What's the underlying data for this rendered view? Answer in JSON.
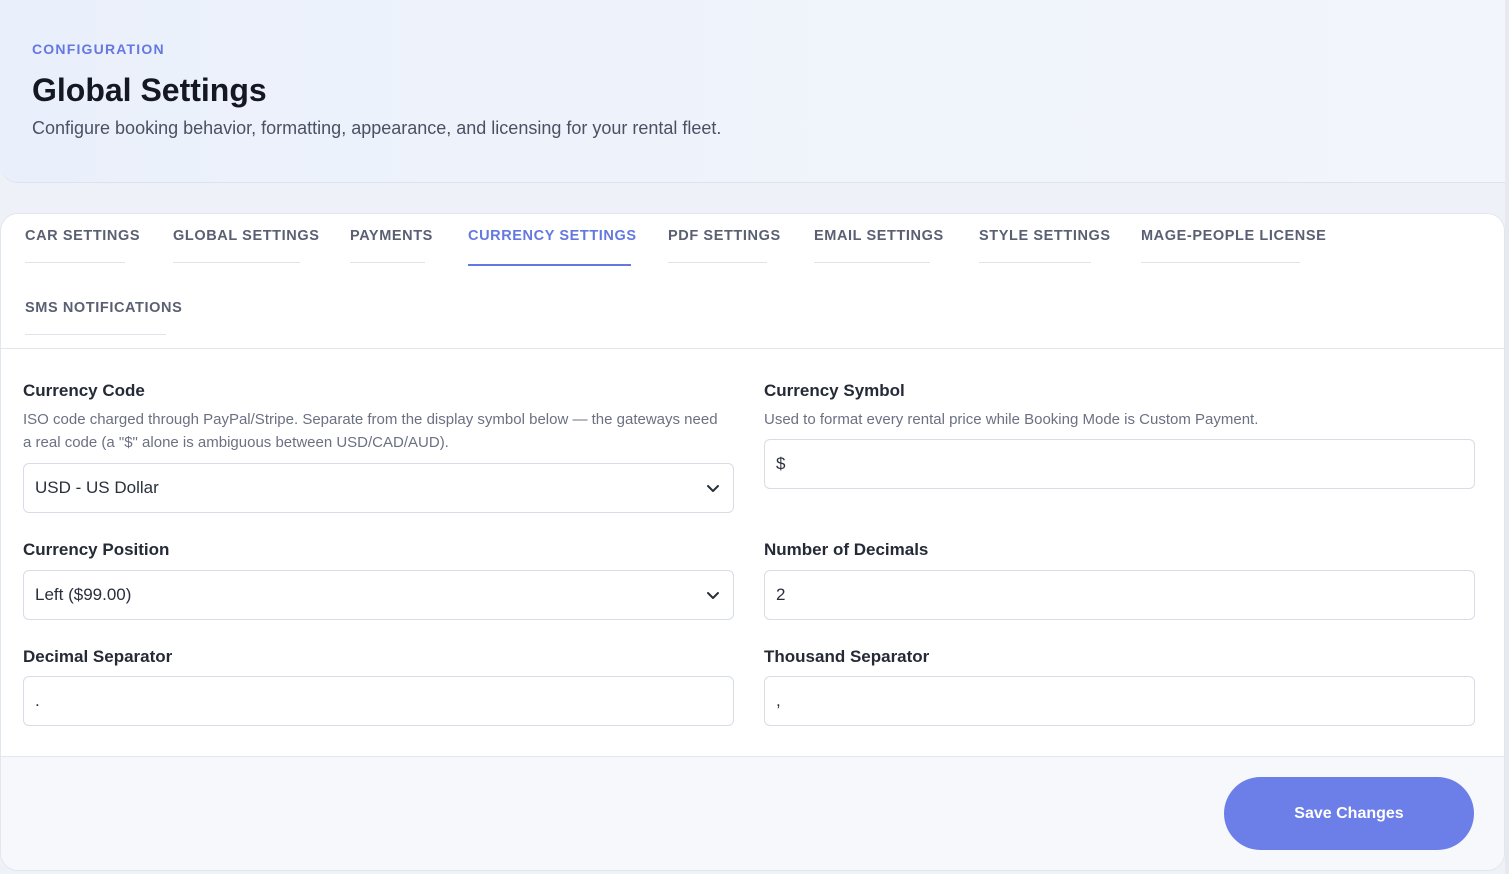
{
  "header": {
    "eyebrow": "CONFIGURATION",
    "title": "Global Settings",
    "subtitle": "Configure booking behavior, formatting, appearance, and licensing for your rental fleet."
  },
  "tabs": [
    {
      "label": "CAR SETTINGS",
      "active": false
    },
    {
      "label": "GLOBAL SETTINGS",
      "active": false
    },
    {
      "label": "PAYMENTS",
      "active": false
    },
    {
      "label": "CURRENCY SETTINGS",
      "active": true
    },
    {
      "label": "PDF SETTINGS",
      "active": false
    },
    {
      "label": "EMAIL SETTINGS",
      "active": false
    },
    {
      "label": "STYLE SETTINGS",
      "active": false
    },
    {
      "label": "MAGE-PEOPLE LICENSE",
      "active": false
    },
    {
      "label": "SMS NOTIFICATIONS",
      "active": false
    }
  ],
  "fields": {
    "currency_code": {
      "label": "Currency Code",
      "help": "ISO code charged through PayPal/Stripe. Separate from the display symbol below — the gateways need a real code (a \"$\" alone is ambiguous between USD/CAD/AUD).",
      "value": "USD - US Dollar"
    },
    "currency_symbol": {
      "label": "Currency Symbol",
      "help": "Used to format every rental price while Booking Mode is Custom Payment.",
      "value": "$"
    },
    "currency_position": {
      "label": "Currency Position",
      "value": "Left ($99.00)"
    },
    "number_of_decimals": {
      "label": "Number of Decimals",
      "value": "2"
    },
    "decimal_separator": {
      "label": "Decimal Separator",
      "value": "."
    },
    "thousand_separator": {
      "label": "Thousand Separator",
      "value": ","
    }
  },
  "footer": {
    "save_label": "Save Changes"
  },
  "colors": {
    "accent": "#6478e0",
    "button": "#6c7fe8"
  },
  "icons": {
    "select_chevron": "chevron-down-icon"
  }
}
